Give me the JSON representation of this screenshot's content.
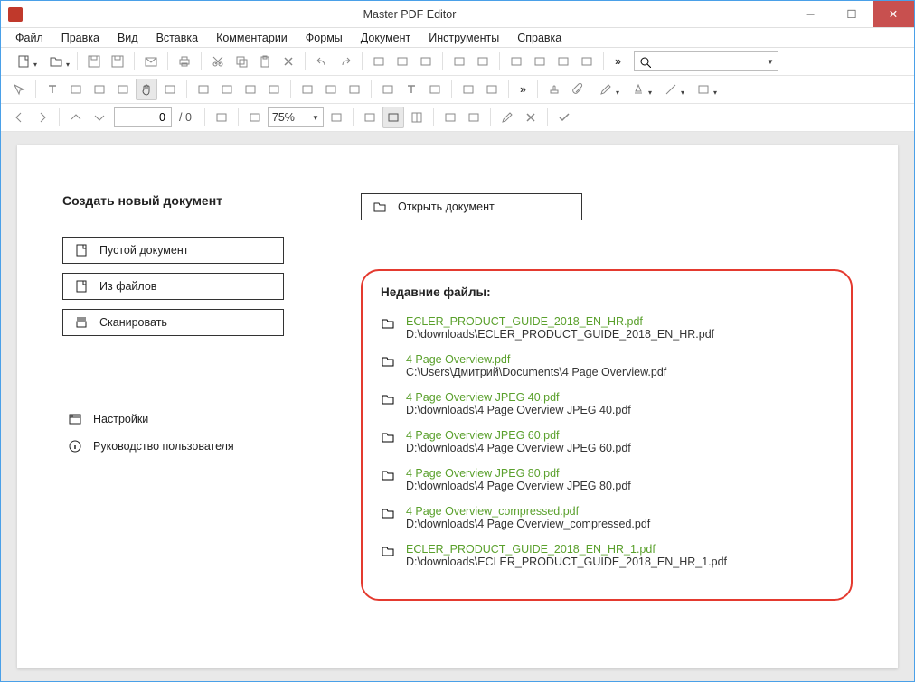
{
  "window": {
    "title": "Master PDF Editor"
  },
  "menu": [
    "Файл",
    "Правка",
    "Вид",
    "Вставка",
    "Комментарии",
    "Формы",
    "Документ",
    "Инструменты",
    "Справка"
  ],
  "toolbar3": {
    "page_value": "0",
    "page_total": "/ 0",
    "zoom": "75%"
  },
  "start": {
    "create_heading": "Создать новый документ",
    "blank": "Пустой документ",
    "from_files": "Из файлов",
    "scan": "Сканировать",
    "settings": "Настройки",
    "guide": "Руководство пользователя",
    "open": "Открыть документ",
    "recent_heading": "Недавние файлы:"
  },
  "recent": [
    {
      "name": "ECLER_PRODUCT_GUIDE_2018_EN_HR.pdf",
      "path": "D:\\downloads\\ECLER_PRODUCT_GUIDE_2018_EN_HR.pdf"
    },
    {
      "name": "4 Page Overview.pdf",
      "path": "C:\\Users\\Дмитрий\\Documents\\4 Page Overview.pdf"
    },
    {
      "name": "4 Page Overview JPEG 40.pdf",
      "path": "D:\\downloads\\4 Page Overview JPEG 40.pdf"
    },
    {
      "name": "4 Page Overview JPEG 60.pdf",
      "path": "D:\\downloads\\4 Page Overview JPEG 60.pdf"
    },
    {
      "name": "4 Page Overview JPEG 80.pdf",
      "path": "D:\\downloads\\4 Page Overview JPEG 80.pdf"
    },
    {
      "name": "4 Page Overview_compressed.pdf",
      "path": "D:\\downloads\\4 Page Overview_compressed.pdf"
    },
    {
      "name": "ECLER_PRODUCT_GUIDE_2018_EN_HR_1.pdf",
      "path": "D:\\downloads\\ECLER_PRODUCT_GUIDE_2018_EN_HR_1.pdf"
    }
  ]
}
